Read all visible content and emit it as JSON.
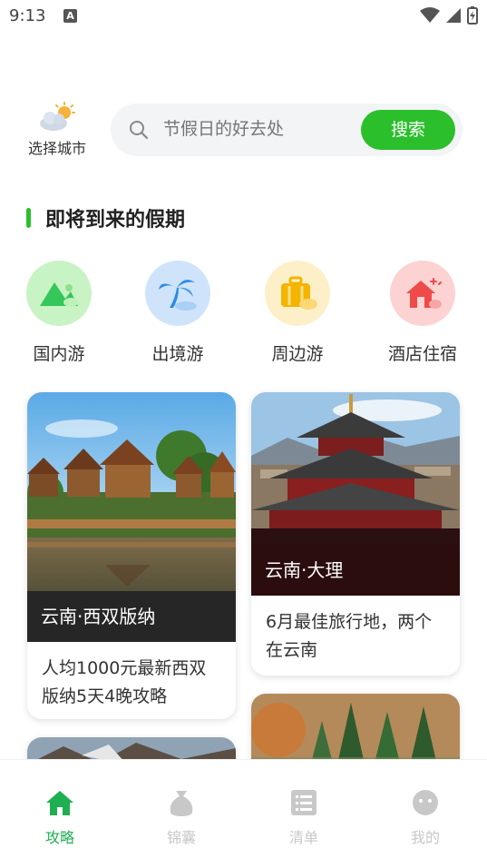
{
  "status_bar": {
    "time": "9:13",
    "notification_letter": "A"
  },
  "header": {
    "city_label": "选择城市",
    "search_placeholder": "节假日的好去处",
    "search_button": "搜索"
  },
  "section": {
    "title": "即将到来的假期"
  },
  "categories": [
    {
      "label": "国内游",
      "icon": "mountain-icon",
      "color": "#34c759"
    },
    {
      "label": "出境游",
      "icon": "palm-tree-icon",
      "color": "#2e8be6"
    },
    {
      "label": "周边游",
      "icon": "suitcase-icon",
      "color": "#f4b400"
    },
    {
      "label": "酒店住宿",
      "icon": "hotel-icon",
      "color": "#ef4a4a"
    }
  ],
  "cards": [
    {
      "caption": "云南·西双版纳",
      "description": "人均1000元最新西双版纳5天4晚攻略"
    },
    {
      "caption": "云南·大理",
      "description": "6月最佳旅行地，两个在云南"
    }
  ],
  "bottom_nav": [
    {
      "label": "攻略",
      "icon": "home-icon",
      "active": true
    },
    {
      "label": "锦囊",
      "icon": "bag-icon",
      "active": false
    },
    {
      "label": "清单",
      "icon": "list-icon",
      "active": false
    },
    {
      "label": "我的",
      "icon": "profile-icon",
      "active": false
    }
  ],
  "colors": {
    "accent": "#2bbf2b",
    "nav_active": "#1fae52",
    "nav_inactive": "#c8c8c8"
  }
}
